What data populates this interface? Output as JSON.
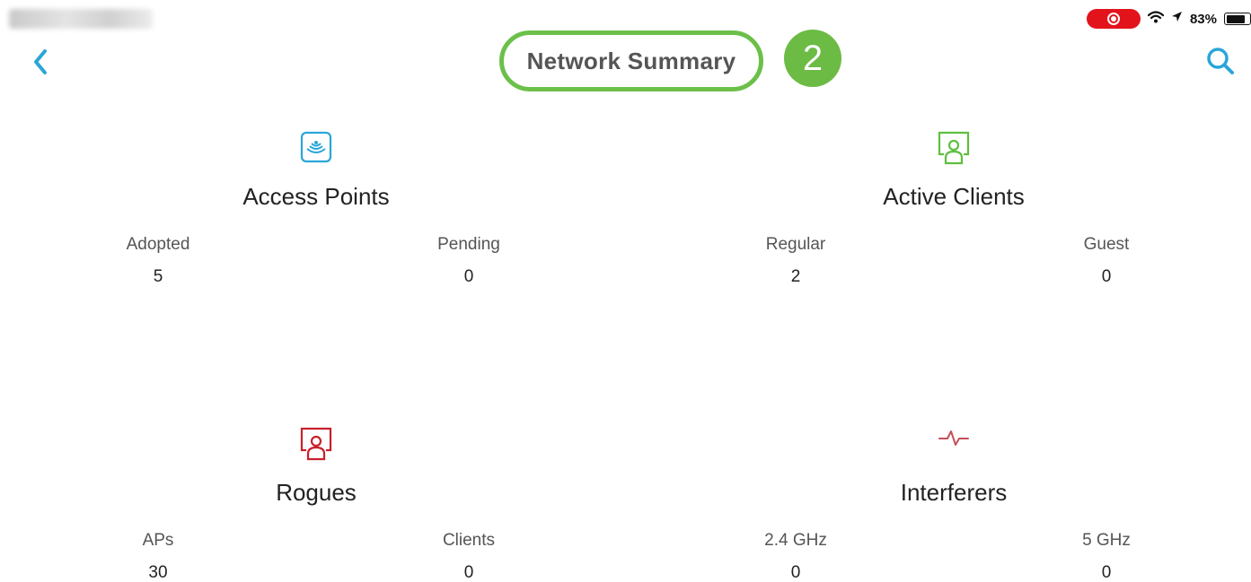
{
  "status_bar": {
    "battery_percent": "83%",
    "battery_level": 0.83,
    "recording": true
  },
  "nav": {
    "title": "Network Summary",
    "step_badge": "2",
    "back_icon": "chevron-left-icon",
    "search_icon": "search-icon"
  },
  "colors": {
    "accent_blue": "#2aa6d8",
    "highlight_green": "#6cc04a",
    "clients_green": "#5fbf3f",
    "rogue_red": "#c8202b",
    "interferer_red": "#c4505a"
  },
  "cards": {
    "access_points": {
      "icon": "access-point-icon",
      "title": "Access Points",
      "stats": [
        {
          "label": "Adopted",
          "value": "5"
        },
        {
          "label": "Pending",
          "value": "0"
        }
      ]
    },
    "active_clients": {
      "icon": "client-icon",
      "title": "Active Clients",
      "stats": [
        {
          "label": "Regular",
          "value": "2"
        },
        {
          "label": "Guest",
          "value": "0"
        }
      ]
    },
    "rogues": {
      "icon": "rogue-icon",
      "title": "Rogues",
      "stats": [
        {
          "label": "APs",
          "value": "30"
        },
        {
          "label": "Clients",
          "value": "0"
        }
      ]
    },
    "interferers": {
      "icon": "interferer-icon",
      "title": "Interferers",
      "stats": [
        {
          "label": "2.4 GHz",
          "value": "0"
        },
        {
          "label": "5 GHz",
          "value": "0"
        }
      ]
    }
  }
}
